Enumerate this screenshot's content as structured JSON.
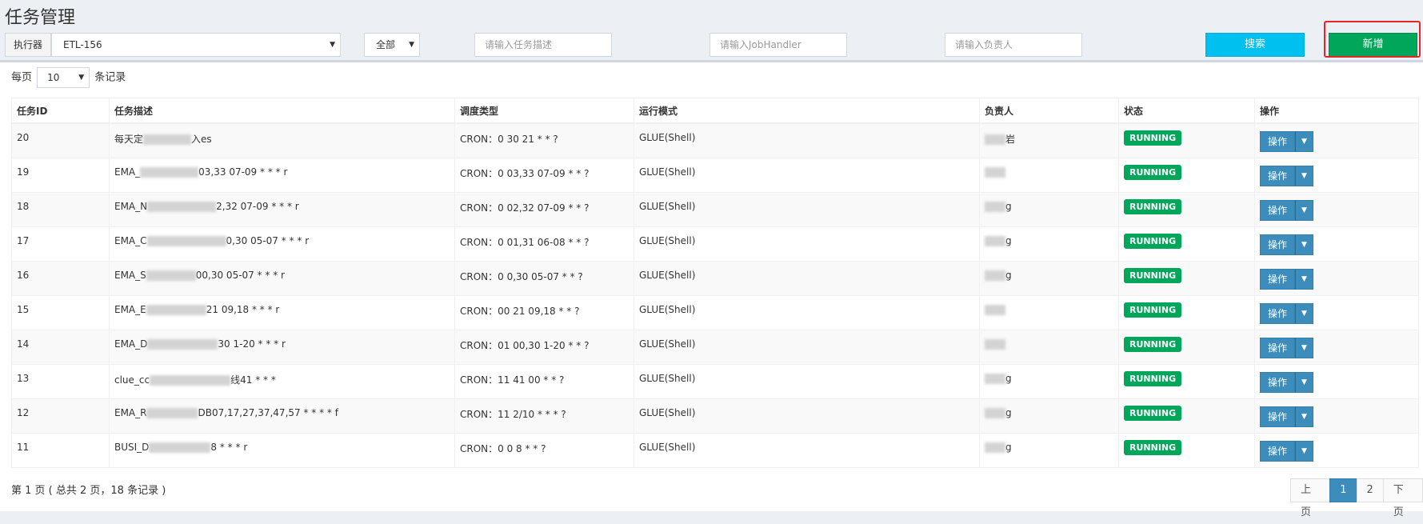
{
  "page": {
    "title": "任务管理"
  },
  "filters": {
    "executor_label": "执行器",
    "executor_value": "ETL-156",
    "status_value": "全部",
    "job_desc_placeholder": "请输入任务描述",
    "handler_placeholder": "请输入JobHandler",
    "author_placeholder": "请输入负责人",
    "search_label": "搜索",
    "add_label": "新增"
  },
  "page_size": {
    "prefix": "每页",
    "value": "10",
    "suffix": "条记录"
  },
  "table": {
    "headers": [
      "任务ID",
      "任务描述",
      "调度类型",
      "运行模式",
      "负责人",
      "状态",
      "操作"
    ],
    "rows": [
      {
        "id": "20",
        "desc_a": "每天定",
        "desc_b": "入es",
        "cron": "CRON：0 30 21 * * ?",
        "mode": "GLUE(Shell)",
        "author": "岩",
        "status": "RUNNING",
        "op": "操作"
      },
      {
        "id": "19",
        "desc_a": "EMA_",
        "desc_b": "03,33 07-09 * * * r",
        "cron": "CRON：0 03,33 07-09 * * ?",
        "mode": "GLUE(Shell)",
        "author": "",
        "status": "RUNNING",
        "op": "操作"
      },
      {
        "id": "18",
        "desc_a": "EMA_N",
        "desc_b": "2,32 07-09 * * * r",
        "cron": "CRON：0 02,32 07-09 * * ?",
        "mode": "GLUE(Shell)",
        "author": "g",
        "status": "RUNNING",
        "op": "操作"
      },
      {
        "id": "17",
        "desc_a": "EMA_C",
        "desc_b": "0,30 05-07 * * * r",
        "cron": "CRON：0 01,31 06-08 * * ?",
        "mode": "GLUE(Shell)",
        "author": "g",
        "status": "RUNNING",
        "op": "操作"
      },
      {
        "id": "16",
        "desc_a": "EMA_S",
        "desc_b": "00,30 05-07 * * * r",
        "cron": "CRON：0 0,30 05-07 * * ?",
        "mode": "GLUE(Shell)",
        "author": "g",
        "status": "RUNNING",
        "op": "操作"
      },
      {
        "id": "15",
        "desc_a": "EMA_E",
        "desc_b": "21 09,18 * * * r",
        "cron": "CRON：00 21 09,18 * * ?",
        "mode": "GLUE(Shell)",
        "author": "",
        "status": "RUNNING",
        "op": "操作"
      },
      {
        "id": "14",
        "desc_a": "EMA_D",
        "desc_b": "30 1-20 * * * r",
        "cron": "CRON：01 00,30 1-20 * * ?",
        "mode": "GLUE(Shell)",
        "author": "",
        "status": "RUNNING",
        "op": "操作"
      },
      {
        "id": "13",
        "desc_a": "clue_cc",
        "desc_b": "线41 * * *",
        "cron": "CRON：11 41 00 * * ?",
        "mode": "GLUE(Shell)",
        "author": "g",
        "status": "RUNNING",
        "op": "操作"
      },
      {
        "id": "12",
        "desc_a": "EMA_R",
        "desc_b": "DB07,17,27,37,47,57 * * * * f",
        "cron": "CRON：11 2/10 * * * ?",
        "mode": "GLUE(Shell)",
        "author": "g",
        "status": "RUNNING",
        "op": "操作"
      },
      {
        "id": "11",
        "desc_a": "BUSI_D",
        "desc_b": "8 * * * r",
        "cron": "CRON：0 0 8 * * ?",
        "mode": "GLUE(Shell)",
        "author": "g",
        "status": "RUNNING",
        "op": "操作"
      }
    ]
  },
  "footer": {
    "info": "第 1 页 ( 总共 2 页，18 条记录 )",
    "prev": "上页",
    "pages": [
      "1",
      "2"
    ],
    "next": "下页"
  }
}
